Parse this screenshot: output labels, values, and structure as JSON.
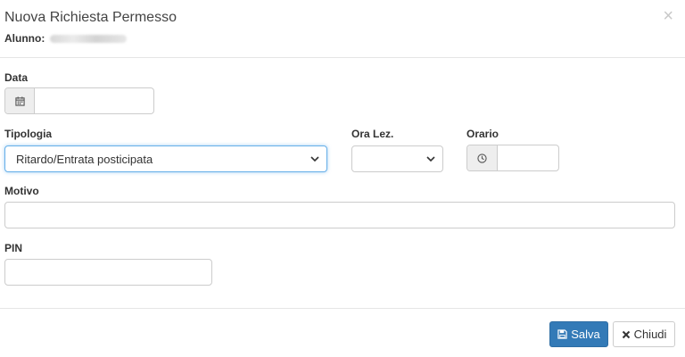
{
  "dialog": {
    "title": "Nuova Richiesta Permesso",
    "student_label": "Alunno:",
    "close_glyph": "×"
  },
  "form": {
    "date": {
      "label": "Data",
      "value": "",
      "icon": "calendar-icon"
    },
    "type": {
      "label": "Tipologia",
      "selected": "Ritardo/Entrata posticipata"
    },
    "lesson_hour": {
      "label": "Ora Lez.",
      "selected": ""
    },
    "time": {
      "label": "Orario",
      "value": "",
      "icon": "clock-icon"
    },
    "reason": {
      "label": "Motivo",
      "value": ""
    },
    "pin": {
      "label": "PIN",
      "value": ""
    }
  },
  "buttons": {
    "save": {
      "label": "Salva",
      "icon": "floppy-disk-icon"
    },
    "close": {
      "label": "Chiudi",
      "icon": "times-icon"
    }
  },
  "colors": {
    "primary": "#337ab7",
    "focus_border": "#66afe9",
    "addon_bg": "#eeeeee"
  }
}
